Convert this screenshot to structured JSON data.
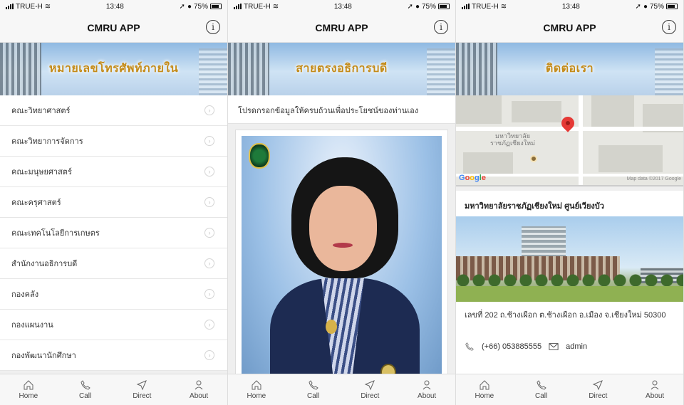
{
  "status_bar": {
    "carrier": "TRUE-H",
    "time": "13:48",
    "battery": "75%"
  },
  "app_title": "CMRU APP",
  "info_icon_glyph": "i",
  "tabs": [
    {
      "label": "Home",
      "icon": "home-icon"
    },
    {
      "label": "Call",
      "icon": "phone-icon"
    },
    {
      "label": "Direct",
      "icon": "navigation-icon"
    },
    {
      "label": "About",
      "icon": "person-icon"
    }
  ],
  "screen_phone_list": {
    "banner_title": "หมายเลขโทรศัพท์ภายใน",
    "items": [
      "คณะวิทยาศาสตร์",
      "คณะวิทยาการจัดการ",
      "คณะมนุษยศาสตร์",
      "คณะครุศาสตร์",
      "คณะเทคโนโลยีการเกษตร",
      "สำนักงานอธิการบดี",
      "กองคลัง",
      "กองแผนงาน",
      "กองพัฒนานักศึกษา"
    ]
  },
  "screen_president": {
    "banner_title": "สายตรงอธิการบดี",
    "notice": "โปรดกรอกข้อมูลให้ครบถ้วนเพื่อประโยชน์ของท่านเอง"
  },
  "screen_contact": {
    "banner_title": "ติดต่อเรา",
    "map_label_line1": "มหาวิทยาลัย",
    "map_label_line2": "ราชภัฏเชียงใหม่",
    "map_logo": "Google",
    "map_data": "Map data ©2017 Google",
    "campus_name": "มหาวิทยาลัยราชภัฏเชียงใหม่ ศูนย์เวียงบัว",
    "address": "เลขที่ 202 ถ.ช้างเผือก ต.ช้างเผือก อ.เมือง จ.เชียงใหม่ 50300",
    "phone": "(+66) 053885555",
    "email": "admin"
  },
  "colors": {
    "banner_text": "#c48b19",
    "pin": "#e53935"
  }
}
